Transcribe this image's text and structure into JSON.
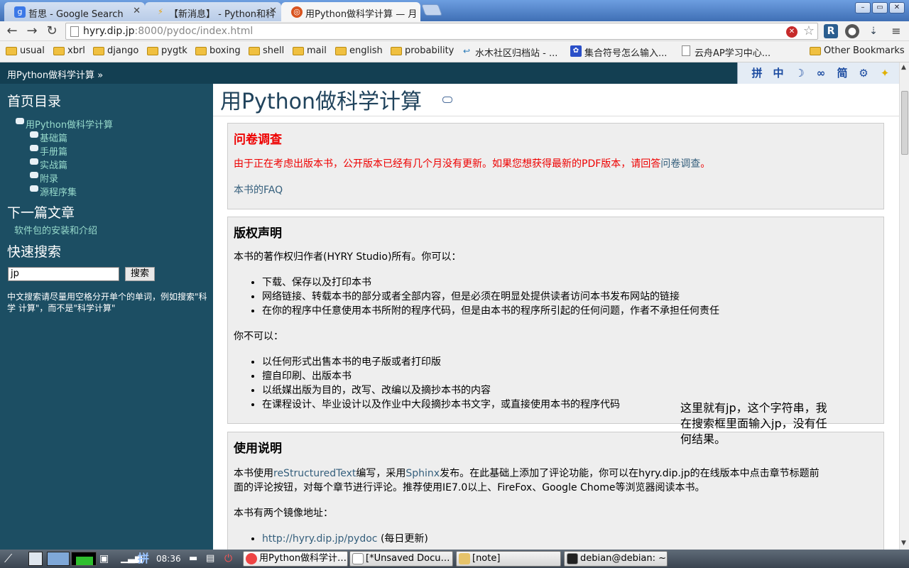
{
  "browser": {
    "tabs": [
      {
        "title": "哲思 - Google Search",
        "favicon": "google-favicon",
        "state": "inactive"
      },
      {
        "title": "【新消息】 - Python和科",
        "favicon": "lightning-favicon",
        "state": "inactive"
      },
      {
        "title": "用Python做科学计算 — 月",
        "favicon": "ubuntu-favicon",
        "state": "active"
      }
    ],
    "url_host": "hyry.dip.jp",
    "url_path": ":8000/pydoc/index.html",
    "bookmarks": [
      {
        "label": "usual",
        "type": "folder"
      },
      {
        "label": "xbrl",
        "type": "folder"
      },
      {
        "label": "django",
        "type": "folder"
      },
      {
        "label": "pygtk",
        "type": "folder"
      },
      {
        "label": "boxing",
        "type": "folder"
      },
      {
        "label": "shell",
        "type": "folder"
      },
      {
        "label": "mail",
        "type": "folder"
      },
      {
        "label": "english",
        "type": "folder"
      },
      {
        "label": "probability",
        "type": "folder"
      },
      {
        "label": "水木社区归档站 - ...",
        "type": "site"
      },
      {
        "label": "集合符号怎么输入...",
        "type": "site"
      },
      {
        "label": "云舟AP学习中心...",
        "type": "page"
      },
      {
        "label": "Other Bookmarks",
        "type": "folder"
      }
    ],
    "ime_toolbar": [
      "拼",
      "中",
      "☽",
      "∞",
      "简",
      "⚙",
      "✦"
    ]
  },
  "relbar": {
    "breadcrumb": "用Python做科学计算 »"
  },
  "sidebar": {
    "toc_title": "首页目录",
    "toc_items": [
      "用Python做科学计算",
      "基础篇",
      "手册篇",
      "实战篇",
      "附录",
      "源程序集"
    ],
    "next_title": "下一篇文章",
    "next_link": "软件包的安装和介绍",
    "search_title": "快速搜索",
    "search_value": "jp",
    "search_button": "搜索",
    "search_hint": "中文搜索请尽量用空格分开单个的单词，例如搜索\"科学 计算\"，而不是\"科学计算\""
  },
  "main": {
    "title": "用Python做科学计算",
    "survey": {
      "heading": "问卷调查",
      "text": "由于正在考虑出版本书，公开版本已经有几个月没有更新。如果您想获得最新的PDF版本，请回答",
      "link": "问卷调查",
      "end": "。",
      "faq": "本书的FAQ"
    },
    "copyright": {
      "heading": "版权声明",
      "intro": "本书的著作权归作者(HYRY Studio)所有。你可以：",
      "can": [
        "下载、保存以及打印本书",
        "网络链接、转载本书的部分或者全部内容，但是必须在明显处提供读者访问本书发布网站的链接",
        "在你的程序中任意使用本书所附的程序代码，但是由本书的程序所引起的任何问题，作者不承担任何责任"
      ],
      "cannot_intro": "你不可以：",
      "cannot": [
        "以任何形式出售本书的电子版或者打印版",
        "擅自印刷、出版本书",
        "以纸媒出版为目的，改写、改编以及摘抄本书的内容",
        "在课程设计、毕业设计以及作业中大段摘抄本书文字，或直接使用本书的程序代码"
      ]
    },
    "usage": {
      "heading": "使用说明",
      "p1_a": "本书使用",
      "p1_link1": "reStructuredText",
      "p1_b": "编写，采用",
      "p1_link2": "Sphinx",
      "p1_c": "发布。在此基础上添加了评论功能，你可以在hyry.dip.jp的在线版本中点击章节标题前",
      "p1_d": "面的评论按钮，对每个章节进行评论。推荐使用IE7.0以上、FireFox、Google Chome等浏览器阅读本书。",
      "mirrors_intro": "本书有两个镜像地址：",
      "mirror1_link": "http://hyry.dip.jp/pydoc",
      "mirror1_note": "(每日更新)"
    },
    "annotation": "这里就有jp，这个字符串，我在搜索框里面输入jp，没有任何结果。"
  },
  "taskbar": {
    "clock": "08:36",
    "tasks": [
      {
        "label": "用Python做科学计…",
        "active": true
      },
      {
        "label": "[*Unsaved Docu…",
        "active": false
      },
      {
        "label": "[note]",
        "active": false
      },
      {
        "label": "debian@debian: ~",
        "active": false
      }
    ]
  }
}
